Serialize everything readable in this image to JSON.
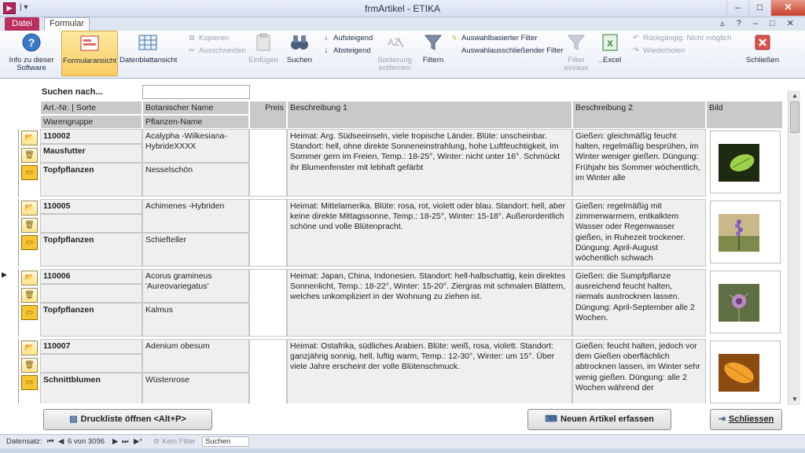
{
  "window": {
    "title": "frmArtikel  -  ETIKA",
    "app_icon": "access-app-icon"
  },
  "tabs": {
    "file": "Datei",
    "active": "Formular"
  },
  "ribbon": {
    "info": "Info zu dieser Software",
    "formview": "Formularansicht",
    "datasheet": "Datenblattansicht",
    "copy": "Kopieren",
    "cut": "Ausschneiden",
    "paste": "Einfügen",
    "find": "Suchen",
    "asc": "Aufsteigend",
    "desc": "Absteigend",
    "sort_remove": "Sortierung entfernen",
    "filter": "Filtern",
    "sel_filter": "Auswahlbasierter Filter",
    "excl_filter": "Auswahlausschließender Filter",
    "filter_onoff": "Filter ein/aus",
    "excel": "..Excel",
    "undo": "Rückgängig: Nicht möglich",
    "redo": "Wiederholen",
    "close": "Schließen"
  },
  "form": {
    "search_label": "Suchen nach...",
    "search_value": "",
    "headers": {
      "artnr_sorte": "Art.-Nr.  |  Sorte",
      "warengruppe": "Warengruppe",
      "bot_name": "Botanischer Name",
      "pfl_name": "Pflanzen-Name",
      "preis": "Preis",
      "beschr1": "Beschreibung 1",
      "beschr2": "Beschreibung 2",
      "bild": "Bild"
    },
    "records": [
      {
        "artnr": "110002",
        "sorte": "Mausfutter",
        "warengruppe": "Topfpflanzen",
        "bot_name": "Acalypha -Wilkesiana-HybrideXXXX",
        "pfl_name": "Nesselschön",
        "preis": "",
        "beschr1": "Heimat: Arg. Südseeinseln, viele tropische Länder. Blüte: unscheinbar. Standort: hell, ohne direkte Sonneneinstrahlung, hohe Luftfeuchtigkeit, im Sommer gern im Freien, Temp.: 18-25°, Winter: nicht unter 16°. Schmückt ihr Blumenfenster mit lebhaft gefärbt",
        "beschr2": "Gießen: gleichmäßig feucht halten, regelmäßig besprühen, im Winter weniger gießen. Düngung: Frühjahr bis Sommer wöchentlich, im Winter alle",
        "img": "leaf-photo"
      },
      {
        "artnr": "110005",
        "sorte": "",
        "warengruppe": "Topfpflanzen",
        "bot_name": "Achimenes -Hybriden",
        "pfl_name": "Schiefteller",
        "preis": "",
        "beschr1": "Heimat: Mittelamerika. Blüte: rosa, rot, violett oder blau. Standort: hell, aber keine direkte Mittagssonne, Temp.: 18-25°, Winter: 15-18°. Außerordentlich schöne und volle Blütenpracht.",
        "beschr2": "Gießen: regelmäßig mit zimmerwarmem, entkalktem Wasser oder Regenwasser gießen, in Ruhezeit trockener. Düngung: April-August wöchentlich schwach",
        "img": "lavender-photo"
      },
      {
        "artnr": "110006",
        "sorte": "",
        "warengruppe": "Topfpflanzen",
        "bot_name": "Acorus gramineus 'Aureovariegatus'",
        "pfl_name": "Kalmus",
        "preis": "",
        "beschr1": "Heimat: Japan, China, Indonesien. Standort: hell-halbschattig, kein direktes Sonnenlicht, Temp.: 18-22°, Winter: 15-20°. Ziergras mit schmalen Blättern, welches unkompliziert in der Wohnung zu ziehen ist.",
        "beschr2": "Gießen: die Sumpfpflanze ausreichend feucht halten, niemals austrocknen lassen. Düngung: April-September alle 2 Wochen.",
        "img": "flower-photo"
      },
      {
        "artnr": "110007",
        "sorte": "",
        "warengruppe": "Schnittblumen",
        "bot_name": "Adenium obesum",
        "pfl_name": "Wüstenrose",
        "preis": "",
        "beschr1": "Heimat: Ostafrika, südliches Arabien. Blüte: weiß, rosa, violett. Standort: ganzjährig sonnig, hell, luftig warm, Temp.: 12-30°, Winter: um 15°. Über viele Jahre erscheint der volle Blütenschmuck.",
        "beschr2": "Gießen: feucht halten, jedoch vor dem Gießen oberflächlich abtrocknen lassen, im Winter sehr wenig gießen. Düngung: alle 2 Wochen während der",
        "img": "orange-leaf-photo"
      }
    ],
    "buttons": {
      "print": "Druckliste öffnen <Alt+P>",
      "new": "Neuen Artikel erfassen",
      "close": "Schliessen"
    }
  },
  "statusbar": {
    "label": "Datensatz:",
    "position": "6 von 3096",
    "filter": "Kein Filter",
    "search": "Suchen"
  },
  "colors": {
    "accent": "#b9305f",
    "active_btn": "#f9cd63",
    "header": "#c9c9c9"
  }
}
